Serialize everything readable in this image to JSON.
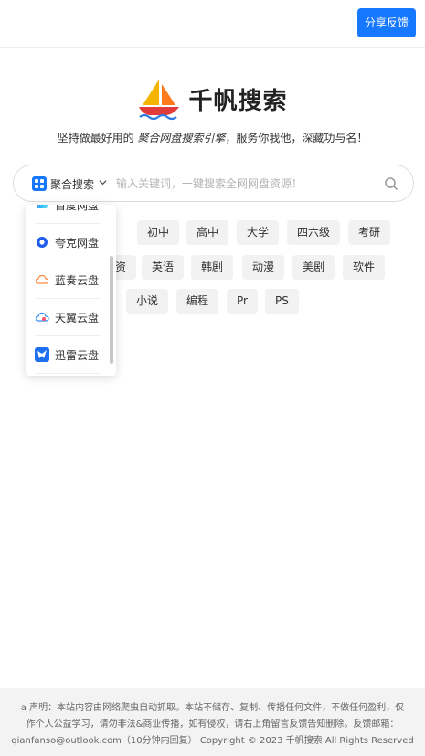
{
  "header": {
    "share_label": "分享反馈"
  },
  "brand": {
    "name": "千帆搜索"
  },
  "tagline": {
    "prefix": "坚持做最好用的 ",
    "emphasis": "聚合网盘搜索引擎",
    "suffix": "，服务你我他，深藏功与名！"
  },
  "search": {
    "engine_label": "聚合搜索",
    "placeholder": "输入关键词，一键搜索全网网盘资源！",
    "value": ""
  },
  "dropdown": {
    "items": [
      {
        "label": "百度网盘",
        "icon": "baidu-pan-icon"
      },
      {
        "label": "夸克网盘",
        "icon": "quark-pan-icon"
      },
      {
        "label": "蓝奏云盘",
        "icon": "lanzou-pan-icon"
      },
      {
        "label": "天翼云盘",
        "icon": "tianyi-pan-icon"
      },
      {
        "label": "迅雷云盘",
        "icon": "xunlei-pan-icon"
      }
    ]
  },
  "tags": [
    "初中",
    "高中",
    "大学",
    "四六级",
    "考研",
    "资",
    "英语",
    "韩剧",
    "动漫",
    "美剧",
    "软件",
    "小说",
    "编程",
    "Pr",
    "PS"
  ],
  "footer": {
    "line1": "a 声明：本站内容由网络爬虫自动抓取。本站不储存、复制、传播任何文件，不做任何盈利，仅",
    "line2": "作个人公益学习，请勿非法&商业传播，如有侵权，请右上角留言反馈告知删除。反馈邮箱：",
    "line3": "qianfanso@outlook.com（10分钟内回复） Copyright © 2023 千帆搜索 All Rights Reserved ."
  },
  "colors": {
    "primary": "#1677ff",
    "tag_bg": "#f2f2f2",
    "footer_bg": "#f3f3f3"
  }
}
